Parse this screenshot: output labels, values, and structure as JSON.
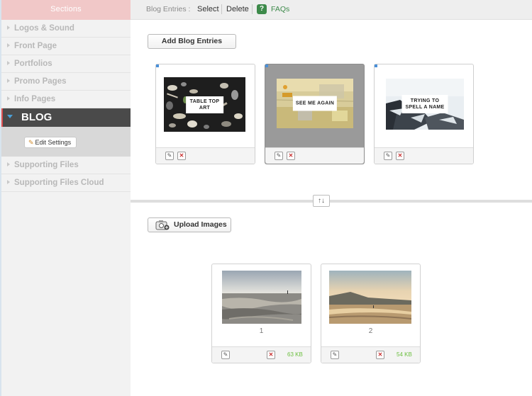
{
  "sidebar": {
    "header": "Sections",
    "items_before": [
      {
        "label": "Logos & Sound"
      },
      {
        "label": "Front Page"
      },
      {
        "label": "Portfolios"
      },
      {
        "label": "Promo Pages"
      },
      {
        "label": "Info Pages"
      }
    ],
    "active_item": {
      "label": "BLOG"
    },
    "edit_settings_label": "Edit Settings",
    "items_after": [
      {
        "label": "Supporting Files"
      },
      {
        "label": "Supporting Files Cloud"
      }
    ]
  },
  "toolbar": {
    "label": "Blog Entries :",
    "select_label": "Select",
    "delete_label": "Delete",
    "faq_icon": "?",
    "faq_label": "FAQs"
  },
  "blog": {
    "add_button_label": "Add Blog Entries",
    "entries": [
      {
        "title": "TABLE TOP\nART",
        "selected": false
      },
      {
        "title": "SEE ME AGAIN",
        "selected": true
      },
      {
        "title": "TRYING TO\nSPELL A NAME",
        "selected": false
      }
    ]
  },
  "resize_handle_glyph": "↑↓",
  "images": {
    "upload_button_label": "Upload Images",
    "items": [
      {
        "index": "1",
        "size": "63 KB"
      },
      {
        "index": "2",
        "size": "54 KB"
      }
    ]
  },
  "colors": {
    "accent_blue": "#4a90d9",
    "faq_green": "#3d8a4a",
    "size_green": "#6bbf3f",
    "delete_red": "#c83030",
    "active_bg": "#4a4a4a"
  }
}
